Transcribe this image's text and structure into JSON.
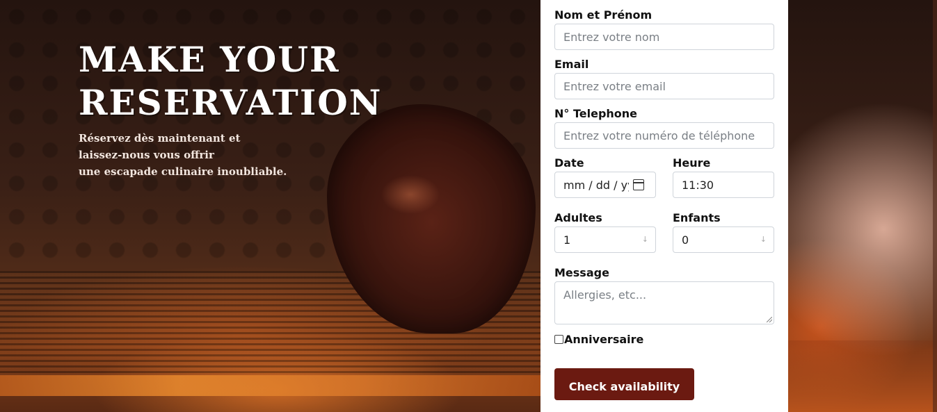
{
  "hero": {
    "title_line1": "MAKE YOUR",
    "title_line2": "RESERVATION",
    "subtitle_line1": "Réservez dès maintenant et",
    "subtitle_line2": "laissez-nous vous offrir",
    "subtitle_line3": "une escapade culinaire inoubliable."
  },
  "form": {
    "name": {
      "label": "Nom et Prénom",
      "placeholder": "Entrez votre nom",
      "value": ""
    },
    "email": {
      "label": "Email",
      "placeholder": "Entrez votre email",
      "value": ""
    },
    "phone": {
      "label": "N° Telephone",
      "placeholder": "Entrez votre numéro de téléphone",
      "value": ""
    },
    "date": {
      "label": "Date",
      "display": "mm / dd / yyy",
      "icon": "calendar-icon"
    },
    "time": {
      "label": "Heure",
      "value": "11:30"
    },
    "adults": {
      "label": "Adultes",
      "value": "1"
    },
    "children": {
      "label": "Enfants",
      "value": "0"
    },
    "message": {
      "label": "Message",
      "placeholder": "Allergies, etc..."
    },
    "birthday": {
      "label": "Anniversaire",
      "checked": false
    },
    "submit_label": "Check availability"
  },
  "colors": {
    "button_bg": "#6b1a11",
    "panel_bg": "#ffffff"
  }
}
